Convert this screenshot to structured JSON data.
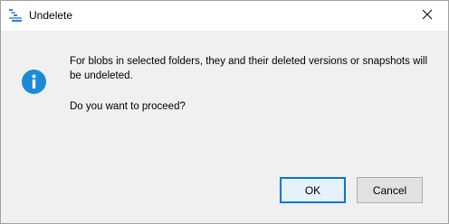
{
  "window": {
    "title": "Undelete",
    "icon": "undelete-app-icon",
    "close_icon": "close-icon"
  },
  "dialog": {
    "icon": "info-icon",
    "message_line1": "For blobs in selected folders, they and their deleted versions or snapshots will be undeleted.",
    "message_line2": "Do you want to proceed?"
  },
  "buttons": {
    "ok_label": "OK",
    "cancel_label": "Cancel"
  },
  "colors": {
    "info_icon": "#1c8ad9",
    "ok_border": "#0078d7",
    "app_icon_blue": "#2b7fd8"
  }
}
